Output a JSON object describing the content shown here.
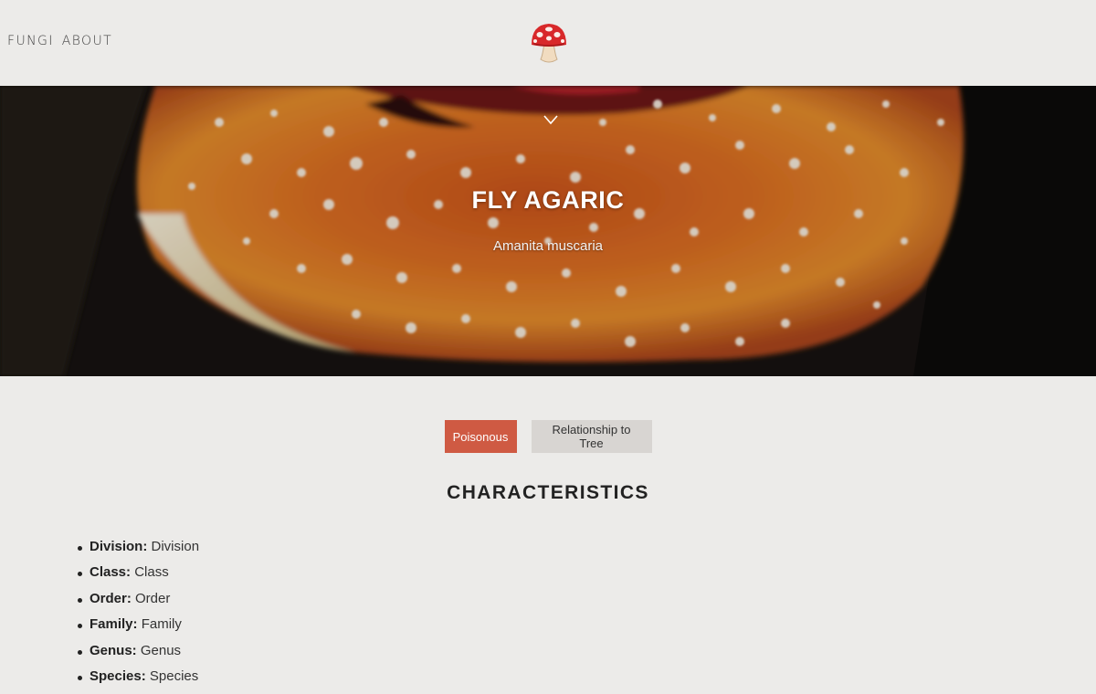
{
  "nav": {
    "links": [
      "FUNGI",
      "ABOUT"
    ],
    "logo_icon": "mushroom-icon"
  },
  "hero": {
    "title": "FLY AGARIC",
    "subtitle": "Amanita muscaria",
    "scroll_icon": "chevron-down-icon"
  },
  "tabs": [
    {
      "label": "Poisonous",
      "active": true
    },
    {
      "label": "Relationship to Tree",
      "active": false
    }
  ],
  "characteristics": {
    "title": "CHARACTERISTICS",
    "items": [
      {
        "label": "Division:",
        "value": "Division"
      },
      {
        "label": "Class:",
        "value": "Class"
      },
      {
        "label": "Order:",
        "value": "Order"
      },
      {
        "label": "Family:",
        "value": "Family"
      },
      {
        "label": "Genus:",
        "value": "Genus"
      },
      {
        "label": "Species:",
        "value": "Species"
      }
    ]
  },
  "colors": {
    "background": "#ecebe9",
    "accent": "#cf5a43",
    "inactive_tab": "#d8d5d2"
  }
}
